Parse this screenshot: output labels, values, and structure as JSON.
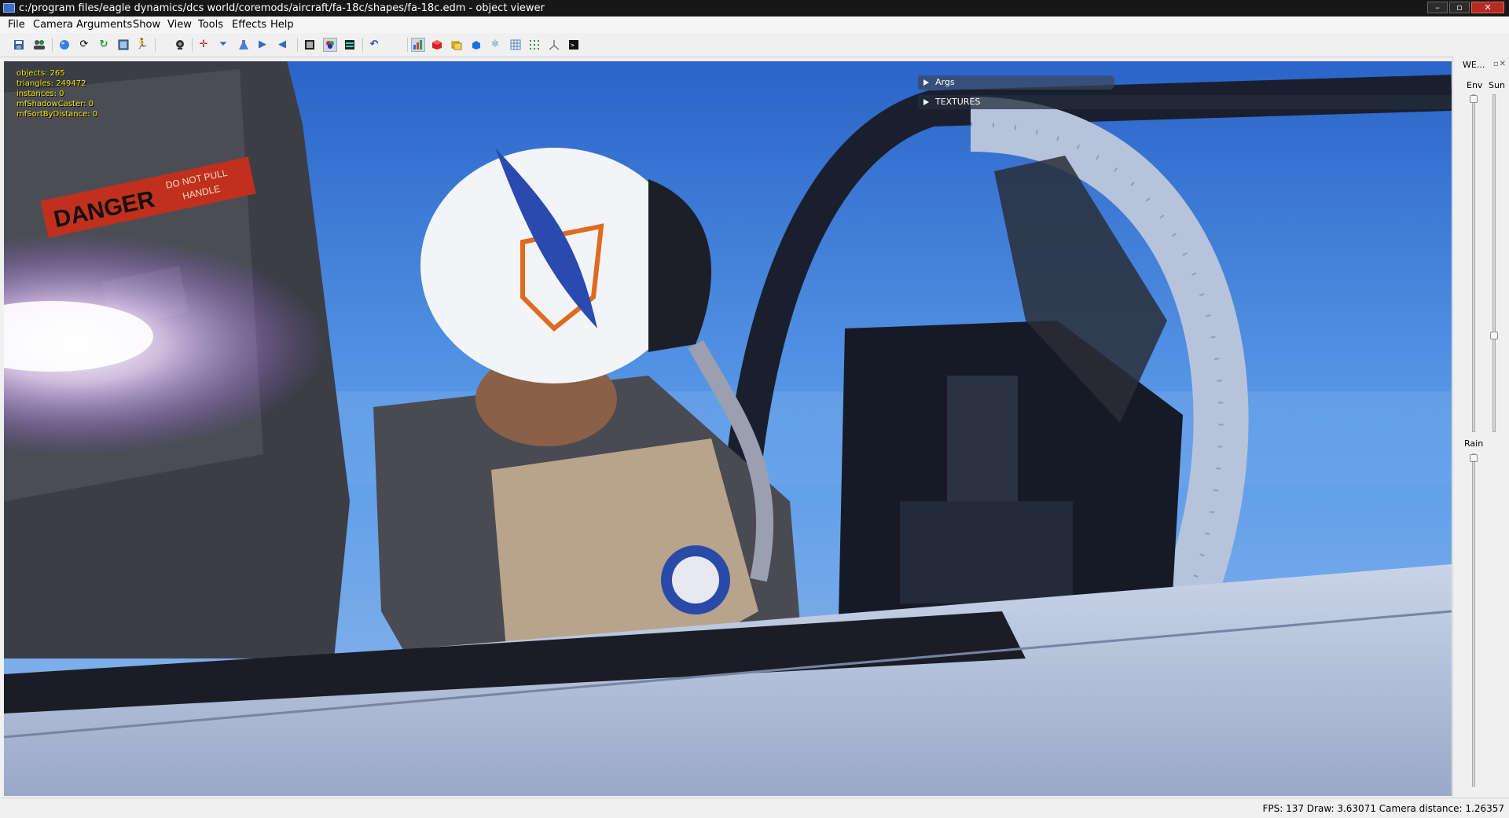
{
  "window": {
    "title": "c:/program files/eagle dynamics/dcs world/coremods/aircraft/fa-18c/shapes/fa-18c.edm - object viewer",
    "minimize": "–",
    "maximize": "▫",
    "close": "✕"
  },
  "menu": {
    "file": "File",
    "camera": "Camera",
    "arguments": "Arguments",
    "show": "Show",
    "view": "View",
    "tools": "Tools",
    "effects": "Effects",
    "help": "Help"
  },
  "toolbar": {
    "icons": [
      "save-icon",
      "users-icon",
      "sphere-icon",
      "refresh-icon",
      "reload-icon",
      "image-icon",
      "running-man-icon",
      "webcam-icon",
      "crosshair-icon",
      "funnel-icon",
      "flask-icon",
      "play-forward-icon",
      "play-back-icon",
      "texture-icon",
      "color-balls-icon",
      "monitor-icon",
      "undo-icon",
      "bar-chart-icon",
      "red-cube-icon",
      "folders-icon",
      "blue-cube-icon",
      "molecule-icon",
      "grid-icon",
      "dots-grid-icon",
      "axes-icon",
      "terminal-icon"
    ]
  },
  "stats": {
    "objects": "objects: 265",
    "triangles": "triangles: 249472",
    "instances": "instances: 0",
    "shadow_caster": "mfShadowCaster: 0",
    "sort_by_distance": "mfSortByDistance: 0"
  },
  "panels": {
    "args": "Args",
    "textures": "TEXTURES"
  },
  "scene_text": {
    "danger": "DANGER",
    "do_not_pull": "DO NOT PULL",
    "handle": "HANDLE"
  },
  "weather": {
    "title": "WE...",
    "env": "Env",
    "sun": "Sun",
    "rain": "Rain",
    "env_level": 0.0,
    "sun_level": 0.72,
    "rain_level": 0.0
  },
  "status": {
    "text": "FPS: 137   Draw: 3.63071   Camera distance: 1.26357"
  },
  "colors": {
    "stats_text": "#f2e600",
    "sky": "#3a78d8",
    "close_button": "#b52b22"
  }
}
